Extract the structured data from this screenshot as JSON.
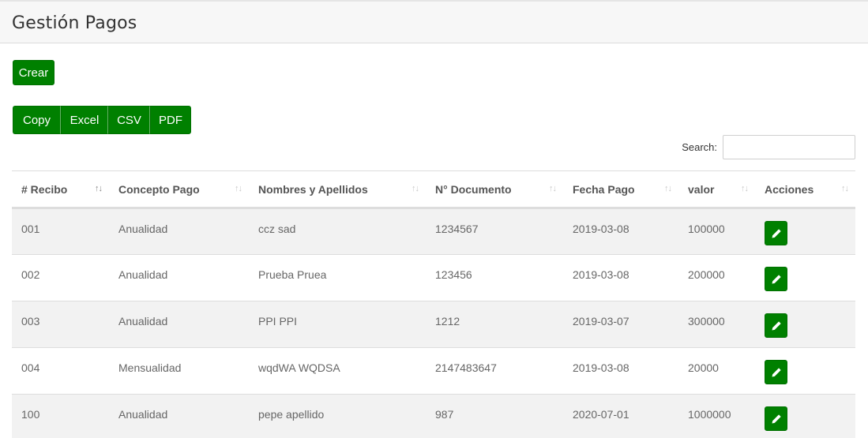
{
  "page": {
    "title": "Gestión Pagos"
  },
  "toolbar": {
    "create_label": "Crear"
  },
  "export_buttons": [
    "Copy",
    "Excel",
    "CSV",
    "PDF"
  ],
  "search": {
    "label": "Search:",
    "value": ""
  },
  "table": {
    "columns": [
      "# Recibo",
      "Concepto Pago",
      "Nombres y Apellidos",
      "N° Documento",
      "Fecha Pago",
      "valor",
      "Acciones"
    ],
    "rows": [
      [
        "001",
        "Anualidad",
        "ccz sad",
        "1234567",
        "2019-03-08",
        "100000"
      ],
      [
        "002",
        "Anualidad",
        "Prueba Pruea",
        "123456",
        "2019-03-08",
        "200000"
      ],
      [
        "003",
        "Anualidad",
        "PPI PPI",
        "1212",
        "2019-03-07",
        "300000"
      ],
      [
        "004",
        "Mensualidad",
        "wqdWA WQDSA",
        "2147483647",
        "2019-03-08",
        "20000"
      ],
      [
        "100",
        "Anualidad",
        "pepe apellido",
        "987",
        "2020-07-01",
        "1000000"
      ]
    ]
  },
  "colors": {
    "accent": "#008000",
    "row_stripe": "#f2f2f2"
  }
}
